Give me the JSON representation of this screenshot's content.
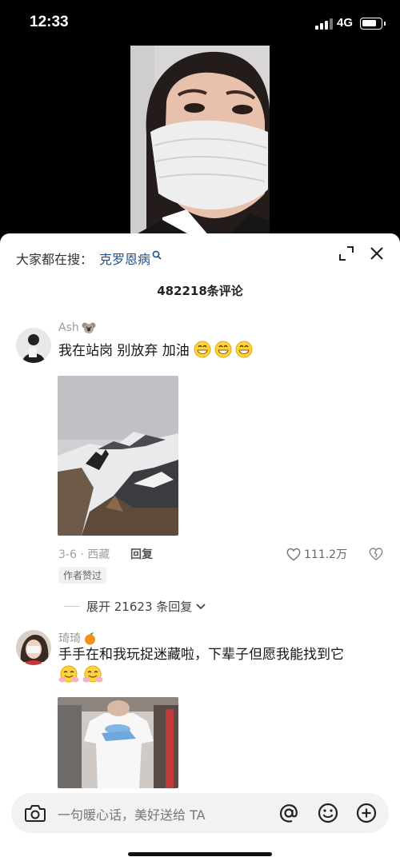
{
  "status_bar": {
    "time": "12:33",
    "network": "4G",
    "icons": [
      "signal-icon",
      "battery-icon"
    ]
  },
  "video": {
    "description_icon": "video-frame"
  },
  "sheet": {
    "search_prefix": "大家都在搜：",
    "search_term": "克罗恩病",
    "comment_count": "482218条评论",
    "icons": [
      "expand-icon",
      "close-icon"
    ]
  },
  "comments": [
    {
      "username": "Ash",
      "text": "我在站岗 别放弃 加油",
      "date": "3-6 · 西藏",
      "reply_label": "回复",
      "likes": "111.2万",
      "author_tag": "作者赞过",
      "expand_replies": "展开 21623 条回复"
    },
    {
      "username": "琦琦",
      "text": "手手在和我玩捉迷藏啦，下辈子但愿我能找到它"
    }
  ],
  "input_bar": {
    "placeholder": "一句暖心话，美好送给 TA",
    "icons": [
      "camera-icon",
      "at-icon",
      "emoji-icon",
      "plus-icon"
    ]
  },
  "colors": {
    "link": "#1f4e8c",
    "sheet_bg": "#ffffff",
    "input_bg": "#f2f2f2"
  }
}
